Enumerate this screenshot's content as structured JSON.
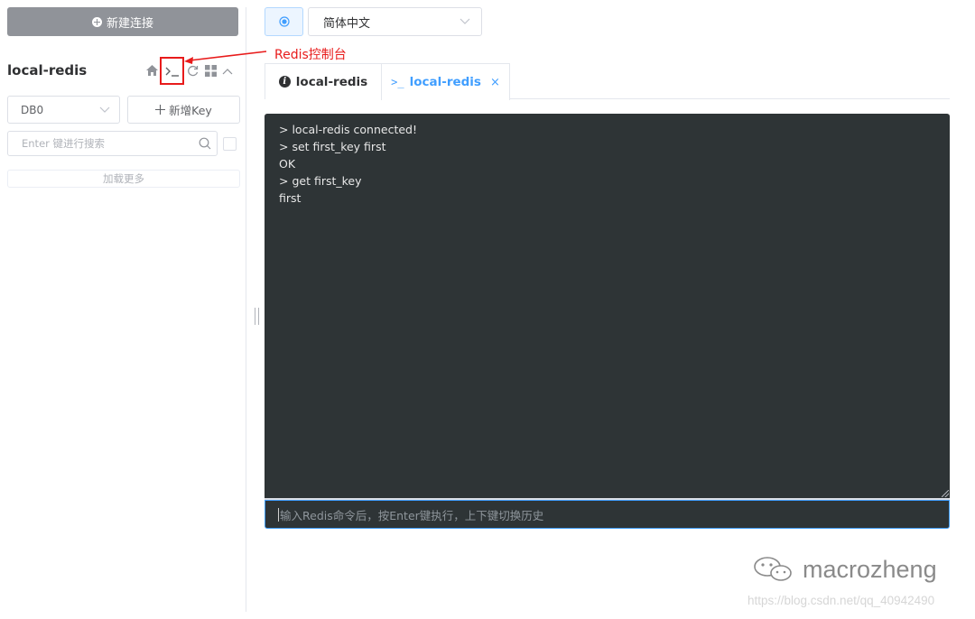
{
  "sidebar": {
    "new_connection_label": "新建连接",
    "connection_name": "local-redis",
    "db_select": {
      "value": "DB0"
    },
    "add_key_label": "新增Key",
    "search_placeholder": "Enter 键进行搜索",
    "load_more_label": "加载更多"
  },
  "annotation": {
    "text": "Redis控制台",
    "color": "#e81b1b"
  },
  "topbar": {
    "language_select": {
      "value": "简体中文"
    }
  },
  "tabs": [
    {
      "label": "local-redis",
      "icon": "info-icon",
      "active": false
    },
    {
      "label": "local-redis",
      "icon": "console-icon",
      "active": true,
      "closable": true
    }
  ],
  "console": {
    "lines": [
      "> local-redis connected!",
      "> set first_key first",
      "OK",
      "> get first_key",
      "first"
    ],
    "input_placeholder": "输入Redis命令后，按Enter键执行，上下键切换历史"
  },
  "watermark": {
    "brand": "macrozheng",
    "url": "https://blog.csdn.net/qq_40942490"
  },
  "colors": {
    "accent": "#409eff",
    "console_bg": "#2e3436",
    "annotation_red": "#e81b1b",
    "new_connection_bg": "#909399"
  }
}
